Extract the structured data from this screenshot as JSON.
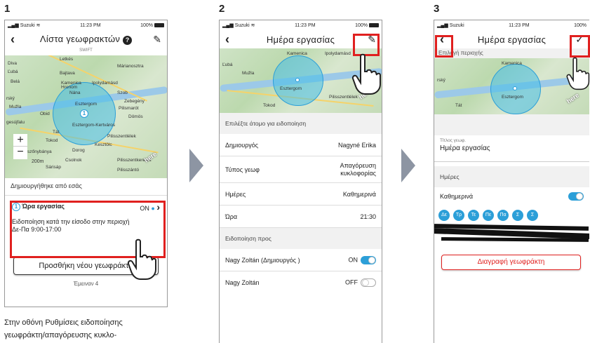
{
  "steps": [
    "1",
    "2",
    "3"
  ],
  "status": {
    "carrier": "Suzuki",
    "time": "11:23 PM",
    "battery": "100%"
  },
  "screen1": {
    "title": "Λίστα γεωφρακτών",
    "subtitle": "SWIFT",
    "map_labels": [
      "Diva",
      "Ľubá",
      "Belá",
      "rský",
      "Mužla",
      "Obid",
      "gesújfalu",
      "Letkés",
      "Bajtava",
      "Kamenica",
      "Ipolydamásd",
      "Márianosztra",
      "Nána",
      "Hronom",
      "Szob",
      "Esztergom",
      "Esztergom-Kertváros",
      "Zebegény",
      "Pilismarót",
      "Dömös",
      "Tát",
      "Tokod",
      "Dorog",
      "Kesztölc",
      "Pilisszentlélek",
      "Ebszőnybánya",
      "Csolnok",
      "Pilisszentkereszt",
      "Sárisáp",
      "Pilisszántó"
    ],
    "scale": "200m",
    "created_by": "Δημιουργήθηκε από εσάς",
    "fence_num": "1",
    "fence_name": "Ώρα εργασίας",
    "fence_status": "ON",
    "fence_desc": "Ειδοποίηση κατά την είσοδο στην περιοχή",
    "fence_time": "Δε-Πα 9:00-17:00",
    "add_button": "Προσθήκη νέου γεωφράκτη",
    "remaining": "Έμειναν 4"
  },
  "screen2": {
    "title": "Ημέρα εργασίας",
    "section1": "Επιλέξτε άτομο για ειδοποίηση",
    "rows": [
      {
        "label": "Δημιουργός",
        "value": "Nagyné Erika"
      },
      {
        "label": "Τύπος γεωφ",
        "value": "Απαγόρευση κυκλοφορίας"
      },
      {
        "label": "Ημέρες",
        "value": "Καθημερινά"
      },
      {
        "label": "Ώρα",
        "value": "21:30"
      }
    ],
    "section2": "Ειδοποίηση προς",
    "notify": [
      {
        "name": "Nagy Zoltán (Δημιουργός )",
        "state": "ON"
      },
      {
        "name": "Nagy Zoltán",
        "state": "OFF"
      }
    ]
  },
  "screen3": {
    "title": "Ημέρα εργασίας",
    "area_label": "Επιλογή περιοχής",
    "name_label": "Τίτλος γεωφ.",
    "name_value": "Ημέρα εργασίας",
    "days_section": "Ημέρες",
    "days_row": "Καθημερινά",
    "days": [
      "Δε",
      "Τρ",
      "Τε",
      "Πε",
      "Πα",
      "Σ",
      "Σ"
    ],
    "delete_button": "Διαγραφή γεωφράκτη"
  },
  "caption_lines": [
    "Στην οθόνη Ρυθμίσεις ειδοποίησης",
    "γεωφράκτη/απαγόρευσης κυκλο-"
  ],
  "colors": {
    "accent": "#2c9fd8",
    "highlight": "#e0201f",
    "arrow": "#8d95a3"
  }
}
